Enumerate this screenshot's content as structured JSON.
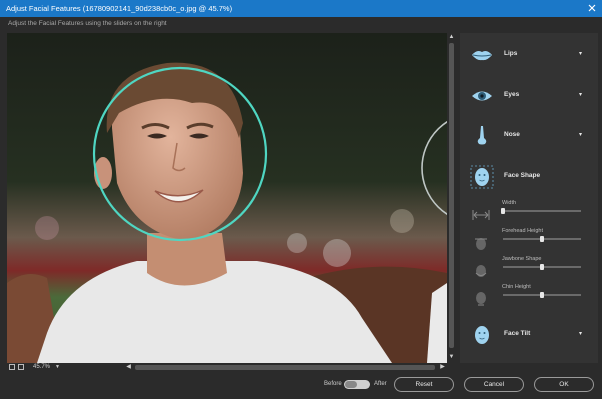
{
  "window": {
    "title": "Adjust Facial Features (16780902141_90d238cb0c_o.jpg @ 45.7%)"
  },
  "instruction": "Adjust the Facial Features using the sliders on the right",
  "viewer": {
    "zoom": "45.7%",
    "zoom_dropdown": "▼"
  },
  "panel": {
    "items": [
      {
        "label": "Lips",
        "icon": "lips-icon",
        "chevron": "▾"
      },
      {
        "label": "Eyes",
        "icon": "eye-icon",
        "chevron": "▾"
      },
      {
        "label": "Nose",
        "icon": "nose-icon",
        "chevron": "▾"
      },
      {
        "label": "Face Shape",
        "icon": "face-shape-icon"
      },
      {
        "label": "Face Tilt",
        "icon": "face-tilt-icon",
        "chevron": "▾"
      }
    ],
    "sliders": [
      {
        "label": "Width",
        "icon": "width-icon",
        "value": 0.0
      },
      {
        "label": "Forehead Height",
        "icon": "forehead-icon",
        "value": 0.5
      },
      {
        "label": "Jawbone Shape",
        "icon": "jawbone-icon",
        "value": 0.5
      },
      {
        "label": "Chin Height",
        "icon": "chin-icon",
        "value": 0.5
      }
    ]
  },
  "bottom": {
    "before_label": "Before",
    "after_label": "After",
    "reset_label": "Reset",
    "cancel_label": "Cancel",
    "ok_label": "OK"
  },
  "colors": {
    "titlebar": "#1b78c8",
    "face_ring": "#4fd6c2",
    "accent_icon": "#9fd3ef"
  }
}
